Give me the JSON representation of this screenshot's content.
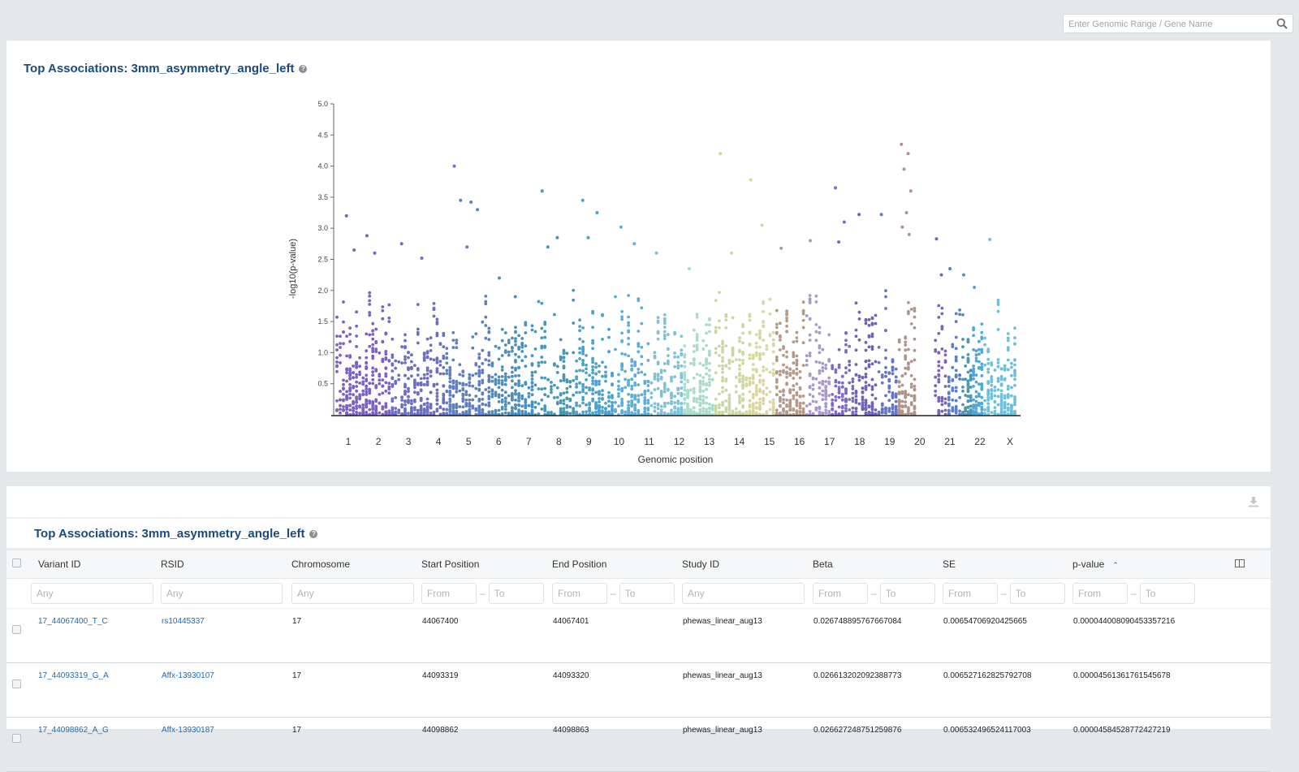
{
  "search": {
    "placeholder": "Enter Genomic Range / Gene Name",
    "value": ""
  },
  "plot_panel": {
    "title": "Top Associations: 3mm_asymmetry_angle_left",
    "help_icon": "question-circle-icon"
  },
  "chart_data": {
    "type": "scatter",
    "subtype": "manhattan",
    "title": "",
    "xlabel": "Genomic position",
    "ylabel": "-log10(p-value)",
    "ylim": [
      0.0,
      5.0
    ],
    "yticks": [
      "5.0",
      "4.5",
      "4.0",
      "3.5",
      "3.0",
      "2.5",
      "2.0",
      "1.5",
      "1.0",
      "0.5"
    ],
    "ytick_values": [
      5.0,
      4.5,
      4.0,
      3.5,
      3.0,
      2.5,
      2.0,
      1.5,
      1.0,
      0.5
    ],
    "categories": [
      "1",
      "2",
      "3",
      "4",
      "5",
      "6",
      "7",
      "8",
      "9",
      "10",
      "11",
      "12",
      "13",
      "14",
      "15",
      "16",
      "17",
      "18",
      "19",
      "20",
      "21",
      "22",
      "X"
    ],
    "grid": false,
    "legend": "none",
    "chromosome_colors": [
      "#7b61c2",
      "#6a6fc5",
      "#5b7fc8",
      "#4a8fbf",
      "#449ab5",
      "#4aa3cf",
      "#5ab0dc",
      "#7cc3d8",
      "#a8dccd",
      "#cbd8a4",
      "#d9d6a0",
      "#b49a8a",
      "#a899c8",
      "#7d6ac4",
      "#7061c0",
      "#6576c6",
      "#b0948a",
      "#8b74c6",
      "#7c63c2",
      "#5a7fc6",
      "#4a96b6",
      "#4ea8da",
      "#72c0d8"
    ],
    "chromosome_max_values": [
      3.2,
      2.75,
      4.0,
      2.2,
      3.6,
      3.45,
      3.0,
      2.6,
      2.35,
      4.2,
      3.78,
      2.68,
      2.8,
      3.65,
      3.22,
      3.22,
      4.35,
      0.0,
      2.83,
      2.35,
      2.25,
      2.05,
      2.82
    ],
    "top_points": [
      {
        "chr": "1",
        "y": 3.2
      },
      {
        "chr": "1",
        "y": 2.88
      },
      {
        "chr": "1",
        "y": 2.65
      },
      {
        "chr": "1",
        "y": 2.6
      },
      {
        "chr": "2",
        "y": 2.75
      },
      {
        "chr": "2",
        "y": 2.52
      },
      {
        "chr": "3",
        "y": 4.0
      },
      {
        "chr": "3",
        "y": 3.42
      },
      {
        "chr": "3",
        "y": 3.45
      },
      {
        "chr": "3",
        "y": 3.3
      },
      {
        "chr": "3",
        "y": 2.7
      },
      {
        "chr": "4",
        "y": 2.2
      },
      {
        "chr": "4",
        "y": 1.9
      },
      {
        "chr": "5",
        "y": 3.6
      },
      {
        "chr": "5",
        "y": 2.85
      },
      {
        "chr": "5",
        "y": 2.7
      },
      {
        "chr": "6",
        "y": 3.45
      },
      {
        "chr": "6",
        "y": 3.25
      },
      {
        "chr": "6",
        "y": 2.85
      },
      {
        "chr": "7",
        "y": 3.02
      },
      {
        "chr": "7",
        "y": 2.75
      },
      {
        "chr": "8",
        "y": 2.6
      },
      {
        "chr": "9",
        "y": 2.35
      },
      {
        "chr": "10",
        "y": 4.2
      },
      {
        "chr": "10",
        "y": 2.6
      },
      {
        "chr": "11",
        "y": 3.78
      },
      {
        "chr": "11",
        "y": 3.05
      },
      {
        "chr": "12",
        "y": 2.68
      },
      {
        "chr": "13",
        "y": 2.8
      },
      {
        "chr": "14",
        "y": 3.65
      },
      {
        "chr": "14",
        "y": 3.1
      },
      {
        "chr": "14",
        "y": 2.78
      },
      {
        "chr": "15",
        "y": 3.22
      },
      {
        "chr": "16",
        "y": 3.22
      },
      {
        "chr": "17",
        "y": 4.35
      },
      {
        "chr": "17",
        "y": 4.2
      },
      {
        "chr": "17",
        "y": 3.95
      },
      {
        "chr": "17",
        "y": 3.6
      },
      {
        "chr": "17",
        "y": 3.25
      },
      {
        "chr": "17",
        "y": 3.02
      },
      {
        "chr": "17",
        "y": 2.9
      },
      {
        "chr": "19",
        "y": 2.83
      },
      {
        "chr": "19",
        "y": 2.25
      },
      {
        "chr": "20",
        "y": 2.35
      },
      {
        "chr": "21",
        "y": 2.25
      },
      {
        "chr": "22",
        "y": 2.05
      },
      {
        "chr": "X",
        "y": 2.82
      }
    ]
  },
  "table_panel": {
    "title": "Top Associations: 3mm_asymmetry_angle_left",
    "download_icon": "download-icon",
    "columns_icon": "columns-icon",
    "columns": [
      "Variant ID",
      "RSID",
      "Chromosome",
      "Start Position",
      "End Position",
      "Study ID",
      "Beta",
      "SE",
      "p-value"
    ],
    "sorted_column": "p-value",
    "sort_direction": "ascending",
    "filters": {
      "any": "Any",
      "from": "From",
      "to": "To",
      "range_separator": "–"
    },
    "rows": [
      {
        "variant_id": "17_44067400_T_C",
        "rsid": "rs10445337",
        "chromosome": "17",
        "start": "44067400",
        "end": "44067401",
        "study_id": "phewas_linear_aug13",
        "beta": "0.026748895767667084",
        "se": "0.00654706920425665",
        "pvalue": "0.000044008090453357216"
      },
      {
        "variant_id": "17_44093319_G_A",
        "rsid": "Affx-13930107",
        "chromosome": "17",
        "start": "44093319",
        "end": "44093320",
        "study_id": "phewas_linear_aug13",
        "beta": "0.026613202092388773",
        "se": "0.006527162825792708",
        "pvalue": "0.00004561361761545678"
      },
      {
        "variant_id": "17_44098862_A_G",
        "rsid": "Affx-13930187",
        "chromosome": "17",
        "start": "44098862",
        "end": "44098863",
        "study_id": "phewas_linear_aug13",
        "beta": "0.026627248751259876",
        "se": "0.006532496524117003",
        "pvalue": "0.00004584528772427219"
      }
    ]
  }
}
